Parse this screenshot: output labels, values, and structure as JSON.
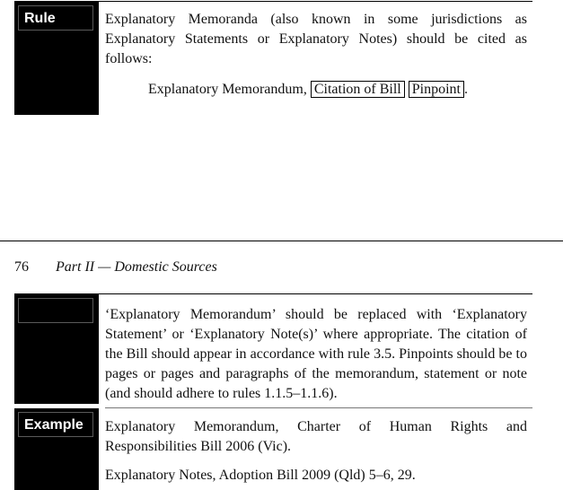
{
  "top_section": {
    "label": "Rule",
    "paragraph": "Explanatory Memoranda (also known in some jurisdictions as Explanatory Statements or Explanatory Notes) should be cited as follows:",
    "citation_prefix": "Explanatory Memorandum,",
    "citation_box_1": "Citation of Bill",
    "citation_box_2": "Pinpoint",
    "citation_suffix": "."
  },
  "page_header": {
    "page_number": "76",
    "running_head": "Part II — Domestic Sources"
  },
  "continued_section": {
    "paragraph": "‘Explanatory Memorandum’ should be replaced with ‘Explanatory Statement’ or ‘Explanatory Note(s)’ where appropriate. The citation of the Bill should appear in accordance with rule 3.5. Pinpoints should be to pages or pages and paragraphs of the memorandum, statement or note (and should adhere to rules 1.1.5–1.1.6)."
  },
  "example_section": {
    "label": "Example",
    "items": [
      "Explanatory Memorandum, Charter of Human Rights and Responsibilities Bill 2006 (Vic).",
      "Explanatory Notes, Adoption Bill 2009 (Qld) 5–6, 29."
    ]
  }
}
